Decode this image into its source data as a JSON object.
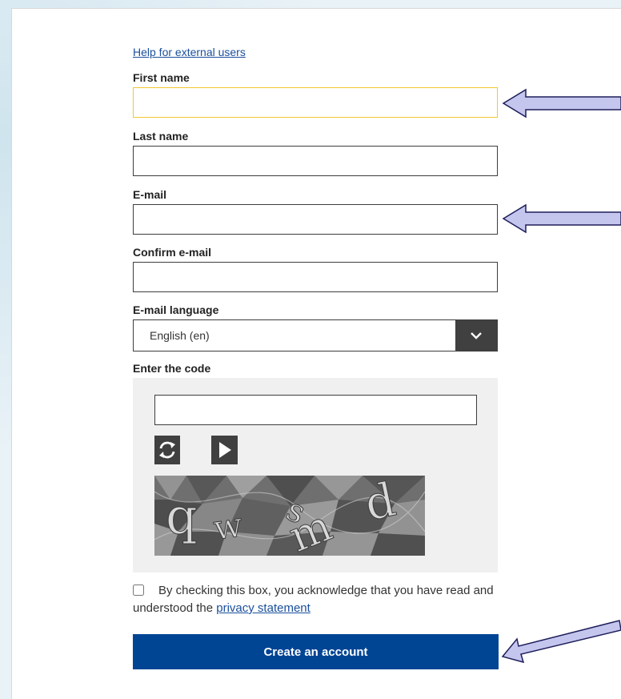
{
  "form": {
    "help_link": "Help for external users",
    "first_name": {
      "label": "First name",
      "value": ""
    },
    "last_name": {
      "label": "Last name",
      "value": ""
    },
    "email": {
      "label": "E-mail",
      "value": ""
    },
    "confirm_email": {
      "label": "Confirm e-mail",
      "value": ""
    },
    "email_language": {
      "label": "E-mail language",
      "selected": "English (en)"
    },
    "captcha": {
      "label": "Enter the code",
      "value": "",
      "refresh_icon": "refresh-icon",
      "play_icon": "play-icon",
      "code_glyphs": [
        "q",
        "w",
        "s",
        "m",
        "d"
      ]
    },
    "consent": {
      "text": "By checking this box, you acknowledge that you have read and understood the",
      "link": "privacy statement",
      "checked": false
    },
    "submit_label": "Create an account"
  },
  "annotations": {
    "arrow_color": "#c5c6ee",
    "arrow_border": "#1e1e5a"
  },
  "colors": {
    "primary_button": "#004494",
    "link": "#1a4f9c",
    "focus_border": "#f2c730",
    "dark_control": "#404040",
    "captcha_panel": "#f0f0f0"
  }
}
